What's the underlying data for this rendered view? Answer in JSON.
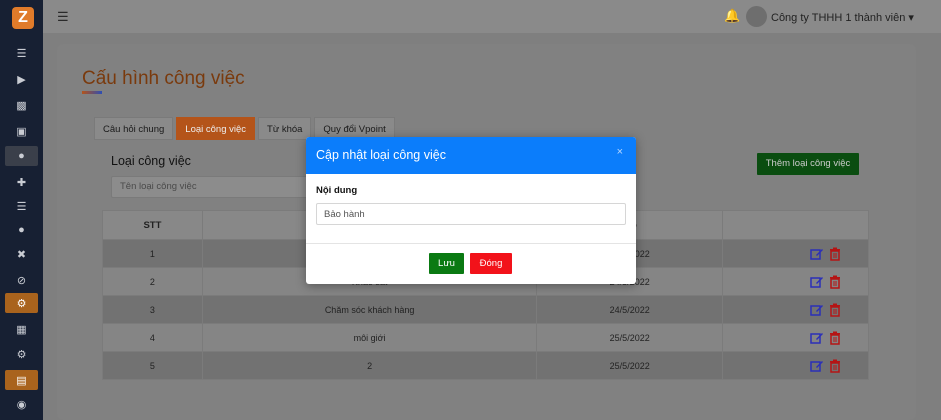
{
  "app": {
    "logo_letter": "Z",
    "user_name": "Công ty THHH 1 thành viên"
  },
  "sidebar": {
    "icons": [
      "list-icon",
      "play-icon",
      "chart-icon",
      "cubes-icon",
      "user-tie-icon",
      "user-plus-icon",
      "list-icon",
      "users-icon",
      "user-times-icon",
      "user-slash-icon",
      "gear-icon",
      "building-icon",
      "gear-icon",
      "table-icon",
      "user-circle-icon"
    ]
  },
  "page": {
    "title": "Cấu hình công việc"
  },
  "tabs": [
    {
      "label": "Câu hỏi chung",
      "active": false
    },
    {
      "label": "Loại công việc",
      "active": true
    },
    {
      "label": "Từ khóa",
      "active": false
    },
    {
      "label": "Quy đổi Vpoint",
      "active": false
    }
  ],
  "section": {
    "title": "Loại công việc",
    "filter_placeholder": "Tên loại công việc",
    "add_button": "Thêm loại công việc"
  },
  "table": {
    "headers": [
      "STT",
      "",
      "tạo",
      ""
    ],
    "rows": [
      {
        "stt": "1",
        "name": "",
        "date": "24/5/2022"
      },
      {
        "stt": "2",
        "name": "Khảo sát",
        "date": "24/5/2022"
      },
      {
        "stt": "3",
        "name": "Chăm sóc khách hàng",
        "date": "24/5/2022"
      },
      {
        "stt": "4",
        "name": "môi giới",
        "date": "25/5/2022"
      },
      {
        "stt": "5",
        "name": "2",
        "date": "25/5/2022"
      }
    ]
  },
  "modal": {
    "title": "Cập nhật loại công việc",
    "close_glyph": "×",
    "field_label": "Nội dung",
    "field_value": "Bảo hành",
    "save_label": "Lưu",
    "close_label": "Đóng"
  },
  "colors": {
    "accent": "#e07b2a",
    "modal_header": "#0b7dfb",
    "save": "#0a7a12",
    "close": "#f2121a"
  }
}
